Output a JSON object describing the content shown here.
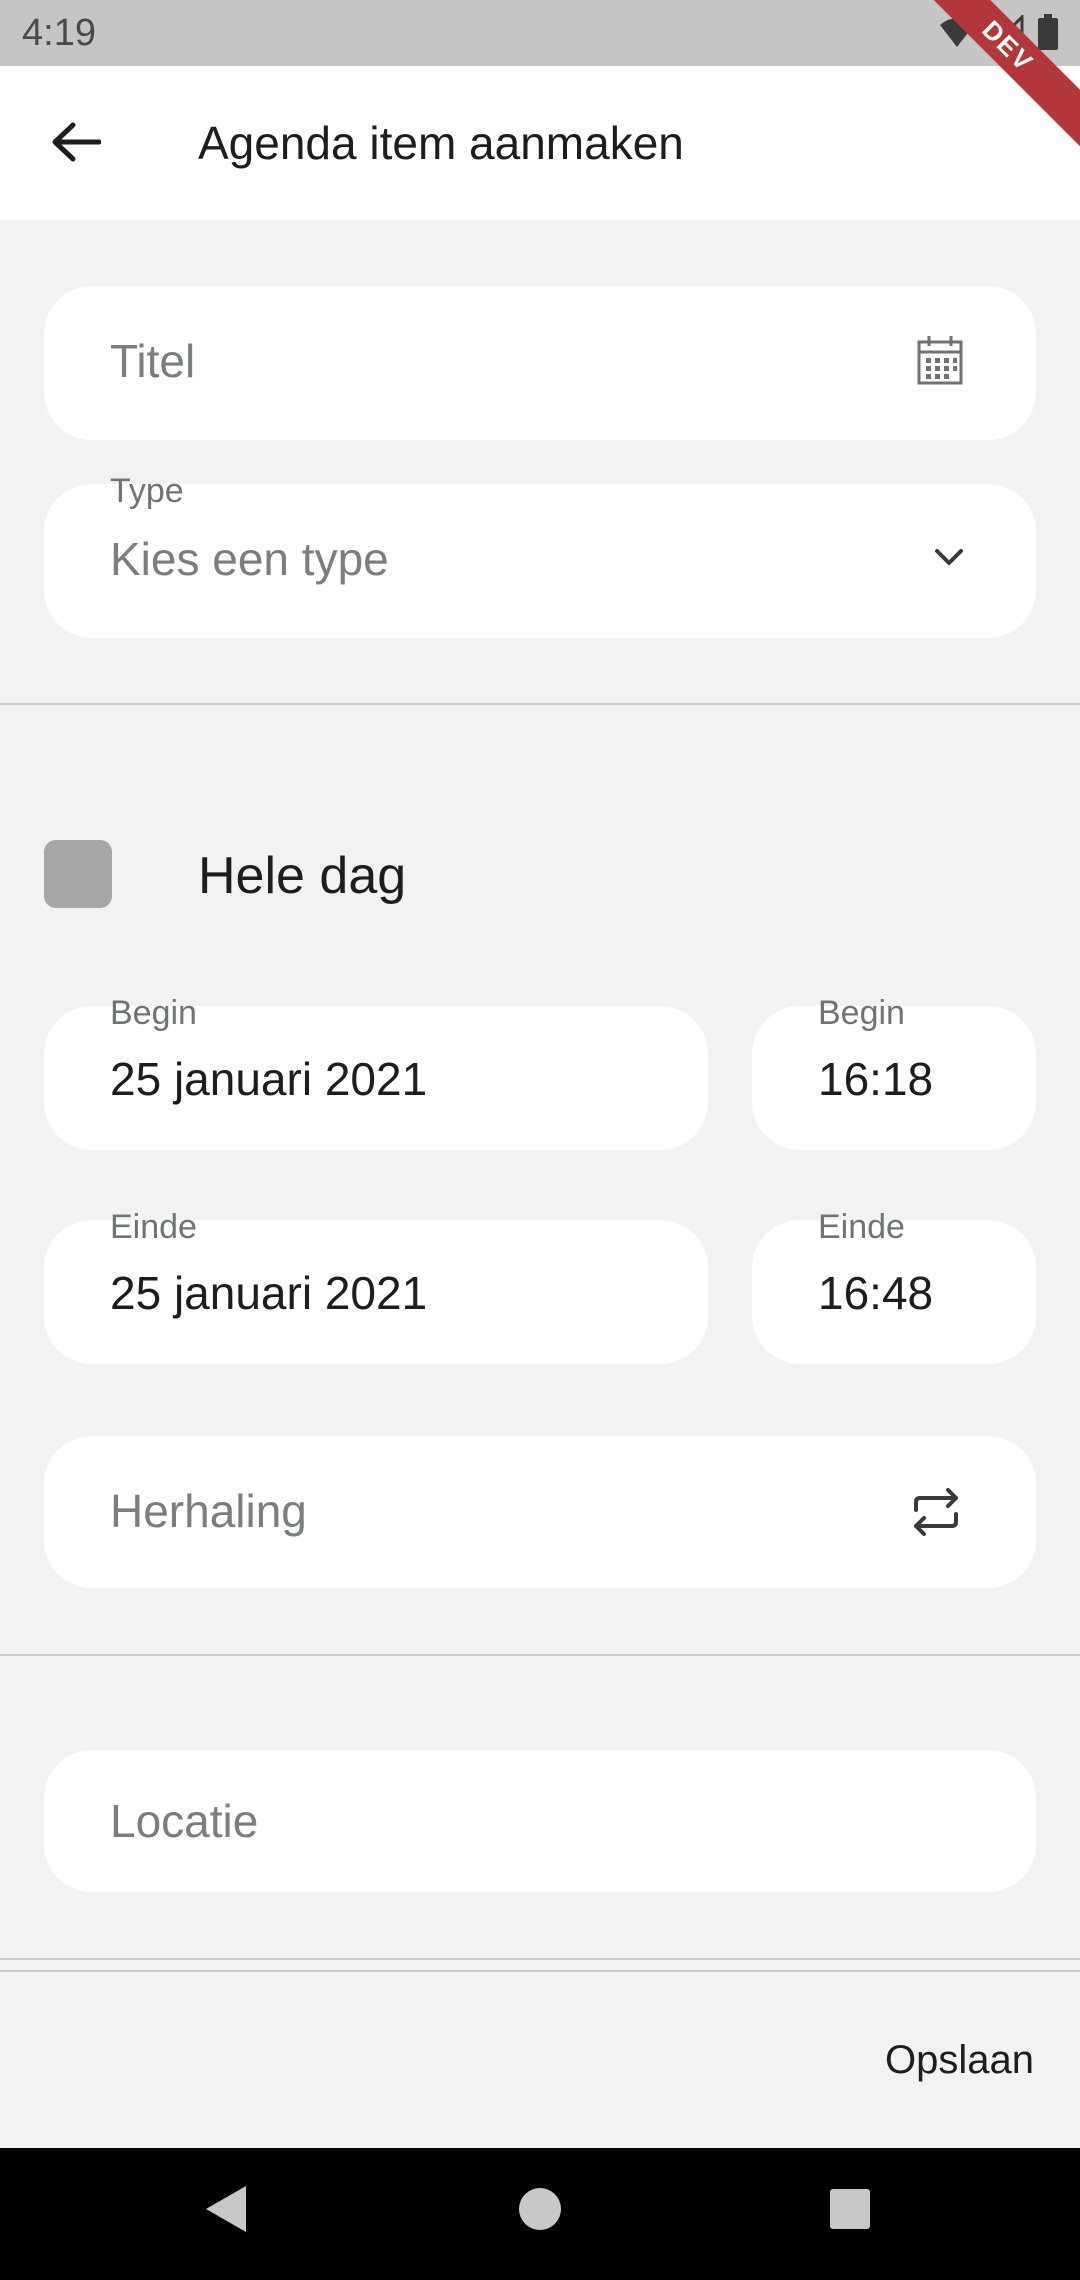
{
  "status_bar": {
    "time": "4:19",
    "dev_banner": "DEV"
  },
  "app_bar": {
    "title": "Agenda item aanmaken"
  },
  "form": {
    "title_field": {
      "placeholder": "Titel"
    },
    "type_field": {
      "label": "Type",
      "value": "Kies een type"
    },
    "all_day": {
      "label": "Hele dag",
      "checked": false
    },
    "start_date": {
      "label": "Begin",
      "value": "25 januari 2021"
    },
    "start_time": {
      "label": "Begin",
      "value": "16:18"
    },
    "end_date": {
      "label": "Einde",
      "value": "25 januari 2021"
    },
    "end_time": {
      "label": "Einde",
      "value": "16:48"
    },
    "repeat_field": {
      "placeholder": "Herhaling"
    },
    "location_field": {
      "placeholder": "Locatie"
    }
  },
  "bottom_bar": {
    "save_label": "Opslaan"
  },
  "icons": {
    "back": "arrow-left-icon",
    "calendar": "calendar-icon",
    "dropdown": "chevron-down-icon",
    "repeat": "repeat-icon"
  },
  "colors": {
    "accent_ribbon": "#b3363a",
    "background": "#f1f2f2",
    "field": "#ffffff"
  }
}
